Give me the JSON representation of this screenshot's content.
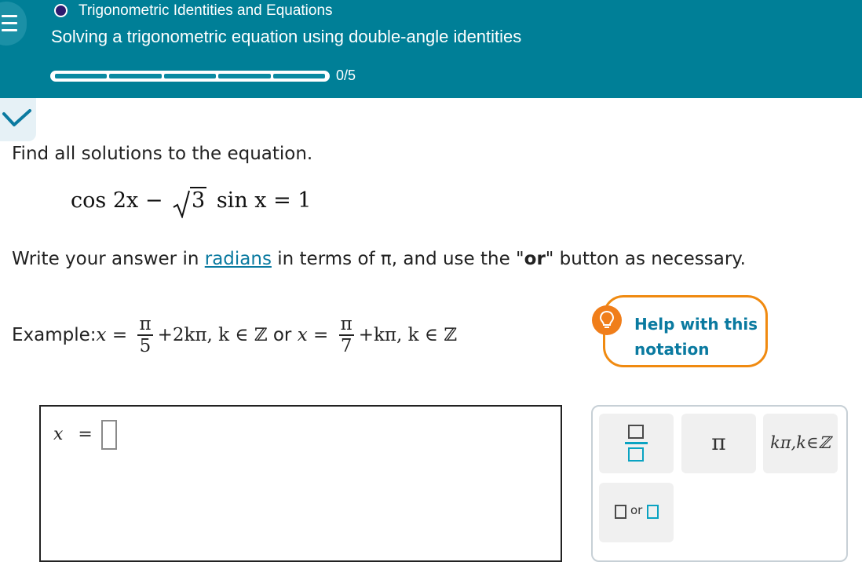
{
  "header": {
    "topic": "Trigonometric Identities and Equations",
    "title": "Solving a trigonometric equation using double-angle identities",
    "progress": {
      "completed": 0,
      "total": 5,
      "label": "0/5"
    },
    "colors": {
      "background": "#007f97",
      "topic_dot": "#2d1b6e"
    }
  },
  "problem": {
    "prompt": "Find all solutions to the equation.",
    "equation": {
      "part1": "cos 2x",
      "minus": "−",
      "root_arg": "3",
      "part2": "sin x = 1"
    },
    "instructions": {
      "before": "Write your answer in ",
      "link": "radians",
      "middle": " in terms of π, and use the \"",
      "bold": "or",
      "after": "\" button as necessary."
    }
  },
  "example": {
    "prefix": "Example: ",
    "x1": "x",
    "eq1": " = ",
    "frac1": {
      "num": "π",
      "den": "5"
    },
    "term1": "+2kπ, k ∈ ℤ",
    "or": " or ",
    "x2": "x",
    "eq2": " = ",
    "frac2": {
      "num": "π",
      "den": "7"
    },
    "term2": "+kπ, k ∈ ℤ"
  },
  "help": {
    "label": "Help with this notation",
    "icon": "lightbulb-icon",
    "accent": "#f08a10"
  },
  "answer": {
    "var": "x",
    "eq": "="
  },
  "palette": {
    "buttons": [
      {
        "name": "fraction",
        "icon": "fraction-icon"
      },
      {
        "name": "pi",
        "label": "π"
      },
      {
        "name": "k-pi",
        "label": "kπ,k∈ℤ"
      },
      {
        "name": "or",
        "label": "or"
      }
    ]
  }
}
